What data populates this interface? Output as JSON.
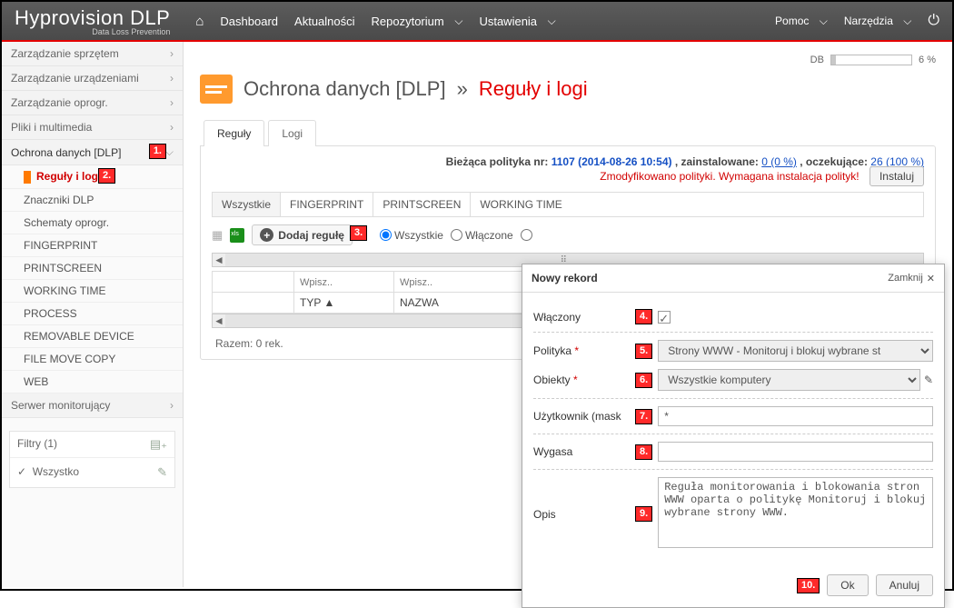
{
  "brand": {
    "name": "Hyprovision",
    "suffix": "DLP",
    "sub": "Data Loss Prevention"
  },
  "nav": {
    "dashboard": "Dashboard",
    "news": "Aktualności",
    "repo": "Repozytorium",
    "settings": "Ustawienia",
    "help": "Pomoc",
    "tools": "Narzędzia"
  },
  "sidebar": {
    "groups": {
      "hardware": "Zarządzanie sprzętem",
      "devices": "Zarządzanie urządzeniami",
      "software": "Zarządzanie oprogr.",
      "media": "Pliki i multimedia",
      "dlp": "Ochrona danych [DLP]",
      "server": "Serwer monitorujący"
    },
    "dlp_items": {
      "rules": "Reguły i logi",
      "markers": "Znaczniki DLP",
      "schemas": "Schematy oprogr.",
      "fingerprint": "FINGERPRINT",
      "printscreen": "PRINTSCREEN",
      "worktime": "WORKING TIME",
      "process": "PROCESS",
      "removable": "REMOVABLE DEVICE",
      "filemove": "FILE MOVE COPY",
      "web": "WEB"
    },
    "filters_title": "Filtry (1)",
    "filters_all": "Wszystko"
  },
  "db": {
    "label": "DB",
    "percent_text": "6 %"
  },
  "title": {
    "a": "Ochrona danych [DLP]",
    "sep": "»",
    "b": "Reguły i logi"
  },
  "outer_tabs": {
    "rules": "Reguły",
    "logs": "Logi"
  },
  "policy": {
    "prefix": "Bieżąca polityka nr:",
    "num": "1107 (2014-08-26 10:54)",
    "installed_lbl": ", zainstalowane:",
    "installed": "0 (0 %)",
    "pending_lbl": ", oczekujące:",
    "pending": "26 (100 %)",
    "warn": "Zmodyfikowano polityki. Wymagana instalacja polityk!",
    "install": "Instaluj"
  },
  "inner_tabs": {
    "all": "Wszystkie",
    "fingerprint": "FINGERPRINT",
    "printscreen": "PRINTSCREEN",
    "worktime": "WORKING TIME"
  },
  "toolbar": {
    "add": "Dodaj regułę",
    "radio_all": "Wszystkie",
    "radio_on": "Włączone"
  },
  "grid": {
    "filter_placeholder": "Wpisz..",
    "col_type": "TYP",
    "col_name": "NAZWA",
    "summary": "Razem: 0 rek."
  },
  "modal": {
    "title": "Nowy rekord",
    "close": "Zamknij",
    "enabled": "Włączony",
    "policy": "Polityka",
    "policy_val": "Strony WWW - Monitoruj i blokuj wybrane st",
    "objects": "Obiekty",
    "objects_val": "Wszystkie komputery",
    "usermask": "Użytkownik (mask",
    "usermask_val": "*",
    "expires": "Wygasa",
    "desc": "Opis",
    "desc_val": "Reguła monitorowania i blokowania stron WWW oparta o politykę Monitoruj i blokuj wybrane strony WWW.",
    "ok": "Ok",
    "cancel": "Anuluj"
  },
  "callouts": {
    "c1": "1.",
    "c2": "2.",
    "c3": "3.",
    "c4": "4.",
    "c5": "5.",
    "c6": "6.",
    "c7": "7.",
    "c8": "8.",
    "c9": "9.",
    "c10": "10."
  }
}
